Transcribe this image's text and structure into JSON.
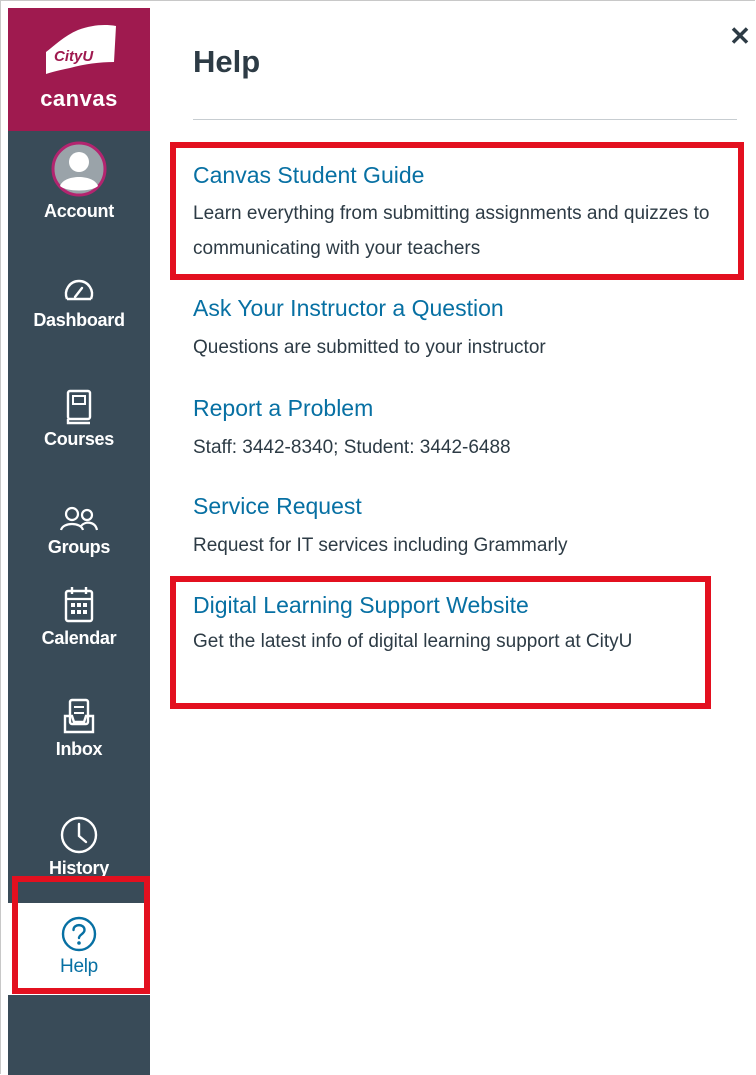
{
  "nav": {
    "logo_text": "CityU",
    "logo_subtitle": "canvas",
    "items": [
      {
        "label": "Account",
        "icon": "avatar-icon"
      },
      {
        "label": "Dashboard",
        "icon": "dashboard-icon"
      },
      {
        "label": "Courses",
        "icon": "courses-icon"
      },
      {
        "label": "Groups",
        "icon": "groups-icon"
      },
      {
        "label": "Calendar",
        "icon": "calendar-icon"
      },
      {
        "label": "Inbox",
        "icon": "inbox-icon"
      },
      {
        "label": "History",
        "icon": "history-icon"
      },
      {
        "label": "Help",
        "icon": "help-icon",
        "active": true
      }
    ]
  },
  "panel": {
    "title": "Help",
    "close_icon": "close-icon",
    "links": [
      {
        "title": "Canvas Student Guide",
        "description": "Learn everything from submitting assignments and quizzes to communicating with your teachers",
        "highlighted": true
      },
      {
        "title": "Ask Your Instructor a Question",
        "description": "Questions are submitted to your instructor",
        "highlighted": false
      },
      {
        "title": "Report a Problem",
        "description": "Staff: 3442-8340; Student: 3442-6488",
        "highlighted": false
      },
      {
        "title": "Service Request",
        "description": "Request for IT services including Grammarly",
        "highlighted": false
      },
      {
        "title": "Digital Learning Support Website",
        "description": "Get the latest info of digital learning support at CityU",
        "highlighted": true
      }
    ]
  },
  "colors": {
    "nav_bg": "#394b58",
    "brand": "#9f1a4f",
    "link": "#0770a3",
    "text": "#2d3b45",
    "highlight": "#e3101f"
  }
}
